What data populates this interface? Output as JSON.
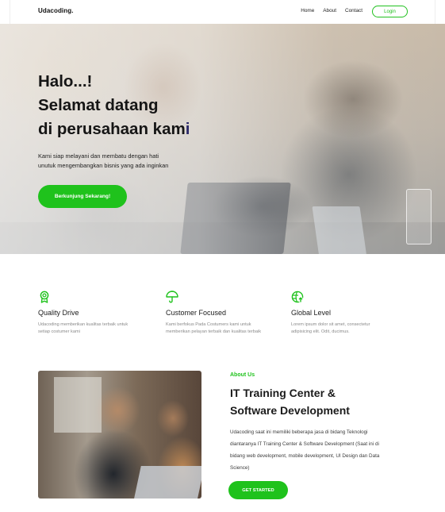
{
  "nav": {
    "brand": "Udacoding.",
    "links": [
      "Home",
      "About",
      "Contact"
    ],
    "login": "Login"
  },
  "hero": {
    "title_line1": "Halo...!",
    "title_line2": "Selamat datang",
    "title_line3_main": "di perusahaan kam",
    "title_line3_accent": "i",
    "subtitle_line1": "Kami siap melayani dan membatu dengan hati",
    "subtitle_line2": "unutuk mengembangkan bisnis yang ada inginkan",
    "cta": "Berkunjung Sekarang!"
  },
  "features": [
    {
      "title": "Quality Drive",
      "icon": "award-icon",
      "desc": "Udacoding memberikan kualitas terbaik untuk setiap costumer kami"
    },
    {
      "title": "Customer Focused",
      "icon": "umbrella-icon",
      "desc": "Kami berfokus Pada Costumers kami untuk memberikan pelayan terbaik dan kualitas terbaik"
    },
    {
      "title": "Global Level",
      "icon": "globe-upload-icon",
      "desc": "Lorem ipsum dolor sit amet, consectetur adipisicing elit. Odit, ducimus."
    }
  ],
  "about": {
    "tag": "About Us",
    "title_line1": "IT Training Center &",
    "title_line2": "Software Development",
    "desc": "Udacoding saat ini memiliki beberapa jasa di bidang Teknologi diantaranya IT Training Center & Software Development (Saat ini di bidang web development, mobile development, UI Design dan Data Science)",
    "cta": "GET STARTED"
  },
  "colors": {
    "accent": "#1fc21c",
    "title_accent": "#2c2a6a"
  }
}
